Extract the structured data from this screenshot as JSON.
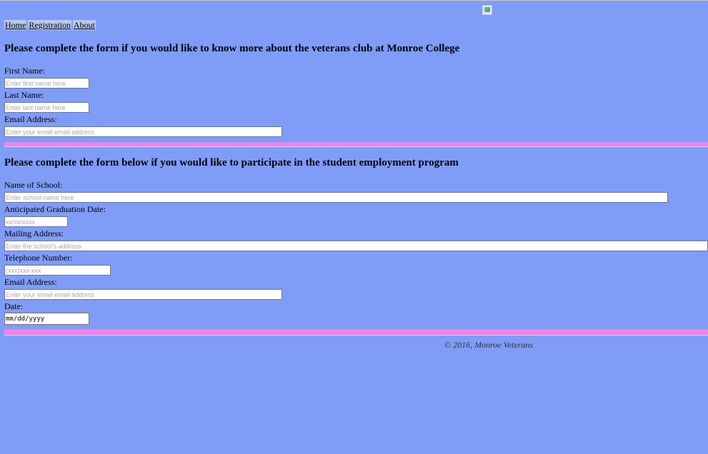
{
  "nav": {
    "items": [
      "Home",
      "Registration",
      "About"
    ]
  },
  "club_form": {
    "heading": "Please complete the form if you would like to know more about the veterans club at Monroe College",
    "first_name_label": "First Name:",
    "first_name_placeholder": "Enter first name here",
    "last_name_label": "Last Name:",
    "last_name_placeholder": "Enter last name here",
    "email_label": "Email Address:",
    "email_placeholder": "Enter your email email address"
  },
  "employment_form": {
    "heading": "Please complete the form below if you would like to participate in the student employment program",
    "school_label": "Name of School:",
    "school_placeholder": "Enter school name here",
    "graduation_label": "Anticipated Graduation Date:",
    "graduation_placeholder": "xx/xx/xxxx",
    "mailing_label": "Mailing Address:",
    "mailing_placeholder": "Enter the school's address",
    "phone_label": "Telephone Number:",
    "phone_placeholder": "(xxx)xxx-xxx",
    "email_label": "Email Address:",
    "email_placeholder": "Enter your email email address",
    "date_label": "Date:",
    "date_value": "mm/dd/yyyy"
  },
  "footer": {
    "text": "© 2016, Monroe Veterans"
  },
  "colors": {
    "background": "#7f9cf7",
    "divider": "#f283e6",
    "nav_background": "#b7c8f0"
  },
  "icons": {
    "broken_image": "broken-image-icon"
  }
}
